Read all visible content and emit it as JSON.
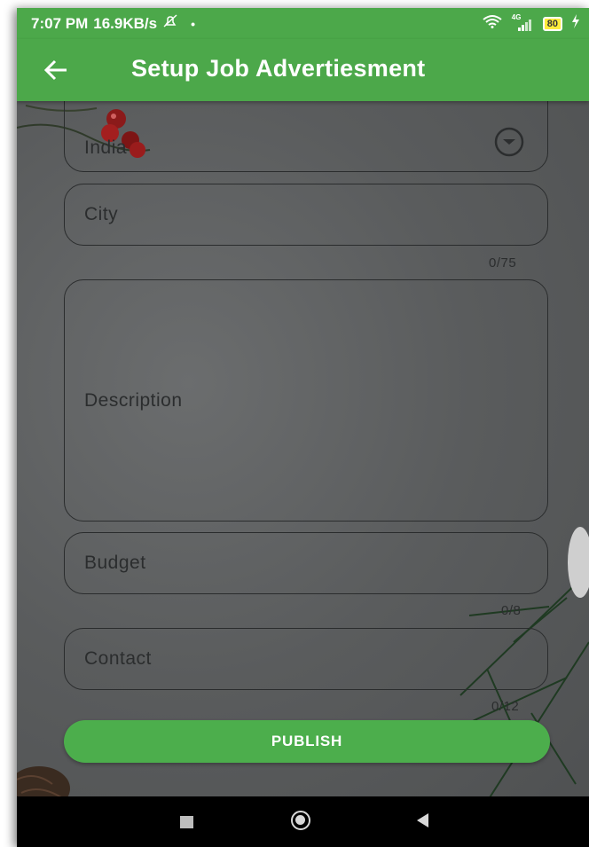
{
  "status_bar": {
    "time": "7:07 PM",
    "speed": "16.9KB/s",
    "network_label": "4G",
    "battery": "80"
  },
  "app_bar": {
    "title": "Setup Job Advertiesment"
  },
  "form": {
    "country": {
      "value": "India"
    },
    "city": {
      "placeholder": "City",
      "counter": "0/75"
    },
    "description": {
      "placeholder": "Description"
    },
    "budget": {
      "placeholder": "Budget",
      "counter": "0/8"
    },
    "contact": {
      "placeholder": "Contact",
      "counter": "0/12"
    }
  },
  "publish_button": {
    "label": "PUBLISH"
  },
  "colors": {
    "primary_green": "#4ca84a",
    "background_gray": "#5b5d5e"
  },
  "icons": {
    "back": "arrow-back-icon",
    "dropdown": "chevron-down-circle-icon",
    "wifi": "wifi-icon",
    "signal": "signal-icon",
    "battery": "battery-icon",
    "muted": "notification-off-icon"
  }
}
